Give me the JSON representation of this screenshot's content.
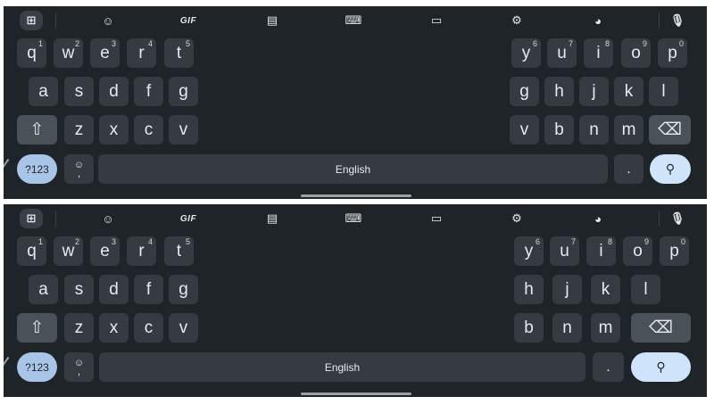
{
  "toolbar": {
    "grid_icon": "grid-icon",
    "sticker_icon": "sticker-icon",
    "gif_label": "GIF",
    "clipboard_icon": "clipboard-icon",
    "keyboard_icon": "keyboard-icon",
    "one_handed_icon": "screen-icon",
    "settings_icon": "gear-icon",
    "theme_icon": "palette-icon",
    "mic_icon": "mic-icon"
  },
  "keys": {
    "q": "q",
    "w": "w",
    "e": "e",
    "r": "r",
    "t": "t",
    "y": "y",
    "u": "u",
    "i": "i",
    "o": "o",
    "p": "p",
    "a": "a",
    "s": "s",
    "d": "d",
    "f": "f",
    "g": "g",
    "h": "h",
    "j": "j",
    "k": "k",
    "l": "l",
    "z": "z",
    "x": "x",
    "c": "c",
    "v": "v",
    "b": "b",
    "n": "n",
    "m": "m",
    "hints": {
      "q": "1",
      "w": "2",
      "e": "3",
      "r": "4",
      "t": "5",
      "y": "6",
      "u": "7",
      "i": "8",
      "o": "9",
      "p": "0"
    },
    "symbols": "?123",
    "space": "English",
    "period": ".",
    "emoji_top": "☺",
    "emoji_bottom": ",",
    "shift_icon": "⇧",
    "backspace_icon": "⌫",
    "search_icon": "⚲"
  },
  "colors": {
    "keyboard_bg": "#1f2428",
    "key_bg": "#353b40",
    "accent": "#a8c4e6",
    "search_bg": "#cfe3fb"
  }
}
